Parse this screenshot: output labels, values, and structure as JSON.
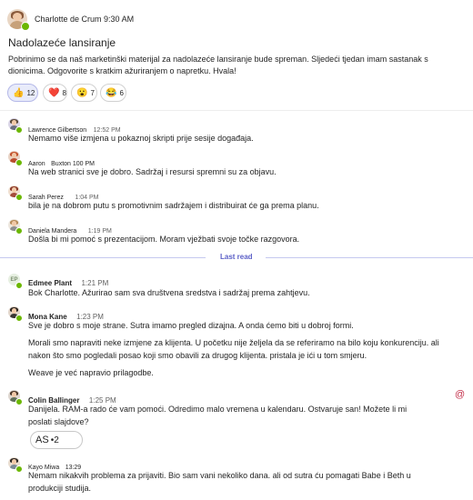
{
  "post": {
    "author": "Charlotte de Crum",
    "time": "9:30 AM",
    "title": "Nadolazeće lansiranje",
    "body": "Pobrinimo se da naš marketinški materijal za nadolazeće lansiranje bude spreman. Sljedeći tjedan imam sastanak s dionicima. Odgovorite s kratkim ažuriranjem o napretku. Hvala!",
    "reactions": [
      {
        "emoji": "👍",
        "icon": "thumbs-up-icon",
        "count": "12"
      },
      {
        "emoji": "❤️",
        "icon": "heart-icon",
        "count": "8"
      },
      {
        "emoji": "😮",
        "icon": "surprised-face-icon",
        "count": "7"
      },
      {
        "emoji": "😂",
        "icon": "laughing-face-icon",
        "count": "6"
      }
    ]
  },
  "replies": [
    {
      "name": "Lawrence Gilbertson",
      "time": "12:52 PM",
      "text": "Nemamo više izmjena u pokaznoj skripti prije sesije događaja."
    },
    {
      "name": "Aaron",
      "time": "Buxton 100 PM",
      "text": "Na web stranici sve je dobro. Sadržaj i resursi spremni su za objavu."
    },
    {
      "name": "Sarah Perez",
      "time": "1:04 PM",
      "text": "bila je na dobrom putu s promotivnim sadržajem i distribuirat će ga prema planu."
    },
    {
      "name": "Daniela Mandera",
      "time": "1:19 PM",
      "text": "Došla bi mi pomoć s prezentacijom. Moram vježbati svoje točke razgovora."
    }
  ],
  "last_read_label": "Last read",
  "new_messages": [
    {
      "name": "Edmee Plant",
      "initials": "EP",
      "time": "1:21 PM",
      "text": "Bok Charlotte. Ažurirao sam sva društvena sredstva i sadržaj prema zahtjevu."
    },
    {
      "name": "Mona Kane",
      "time": "1:23 PM",
      "line1": "Sve je dobro s moje strane. Sutra imamo pregled dizajna. A onda ćemo biti u dobroj formi.",
      "line2": "Morali smo napraviti neke izmjene za klijenta. U početku nije željela da se referiramo na bilo koju konkurenciju. ali nakon što smo pogledali posao koji smo obavili za drugog klijenta. pristala je ići u tom smjeru.",
      "line3": "Weave je već napravio prilagodbe."
    },
    {
      "name": "Colin Ballinger",
      "time": "1:25 PM",
      "mention": "@",
      "text": "Danijela. RAM-a rado će vam pomoći. Odredimo malo vremena u kalendaru. Ostvaruje san! Možete li mi poslati slajdove?",
      "attachment_label": "AS",
      "attachment_extra": "•2"
    },
    {
      "name": "Kayo Miwa",
      "time": "13:29",
      "text": "Nemam nikakvih problema za prijaviti. Bio sam vani nekoliko dana. ali od sutra ću pomagati Babe i Beth u produkciji studija."
    }
  ],
  "colors": {
    "accent": "#5b5fc7",
    "presence": "#6bb700",
    "mention": "#c4314b"
  }
}
